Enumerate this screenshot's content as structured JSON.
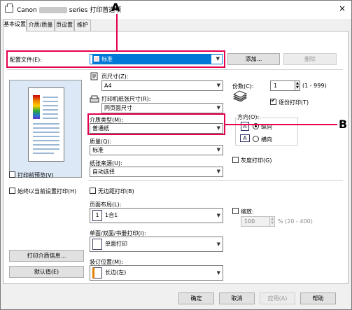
{
  "window": {
    "title_prefix": "Canon",
    "title_suffix": "series 打印首选项",
    "close": "×"
  },
  "tabs": [
    "基本设置",
    "介质/质量",
    "页设置",
    "维护"
  ],
  "profile": {
    "label": "配置文件(E):",
    "value": "标准",
    "add": "添加...",
    "delete": "删除"
  },
  "left": {
    "preview_check": "打印前预览(V)",
    "always_current": "始终以当前设置打印(H)",
    "media_info_btn": "打印介质信息...",
    "defaults_btn": "默认值(E)"
  },
  "page_size": {
    "label": "页尺寸(Z):",
    "value": "A4"
  },
  "paper_size": {
    "label": "打印机纸张尺寸(R):",
    "value": "同页面尺寸"
  },
  "media": {
    "label": "介质类型(M):",
    "value": "普通纸"
  },
  "quality": {
    "label": "质量(Q):",
    "value": "标准"
  },
  "source": {
    "label": "纸张来源(U):",
    "value": "自动选择"
  },
  "copies": {
    "label": "份数(C):",
    "value": "1",
    "range": "(1 - 999)",
    "collate": "逐份打印(T)"
  },
  "orientation": {
    "label": "方向(O):",
    "portrait": "纵向",
    "landscape": "横向",
    "icon_letter": "A"
  },
  "grayscale": "灰度打印(G)",
  "borderless": "无边距打印(B)",
  "layout": {
    "label": "页面布局(L):",
    "value": "1合1",
    "icon_num": "1"
  },
  "duplex": {
    "label": "单面/双面/书册打印(I):",
    "value": "单面打印"
  },
  "binding": {
    "label": "装订位置(M):",
    "value": "长边(左)"
  },
  "scaling": {
    "label": "缩放:",
    "value": "100",
    "range": "% (20 - 400)"
  },
  "buttons": {
    "ok": "确定",
    "cancel": "取消",
    "apply": "应用(A)",
    "help": "帮助"
  },
  "callouts": {
    "a": "A",
    "b": "B"
  },
  "colors": {
    "accent": "#0078d7",
    "callout": "#e5004f"
  }
}
